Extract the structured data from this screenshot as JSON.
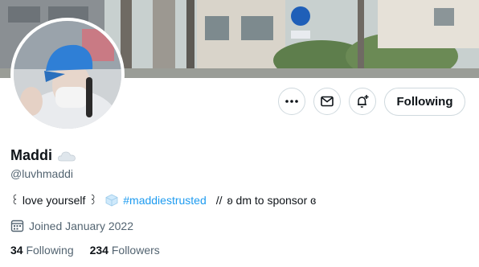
{
  "profile": {
    "display_name": "Maddi",
    "name_emoji": "cloud-icon",
    "handle": "@luvhmaddi",
    "bio": {
      "part1": "꒰ love yourself ꒱",
      "emoji": "ice-cube-icon",
      "hashtag": "#maddiestrusted",
      "part2": "//",
      "part3": "ʚ dm to sponsor ɞ"
    },
    "joined": "Joined January 2022",
    "following_count": "34",
    "following_label": "Following",
    "followers_count": "234",
    "followers_label": "Followers"
  },
  "actions": {
    "more_icon": "more-icon",
    "message_icon": "message-icon",
    "notify_icon": "notification-bell-icon",
    "follow_label": "Following"
  },
  "colors": {
    "accent": "#1d9bf0",
    "text": "#0f1419",
    "muted": "#536471",
    "border": "#cfd9de"
  }
}
